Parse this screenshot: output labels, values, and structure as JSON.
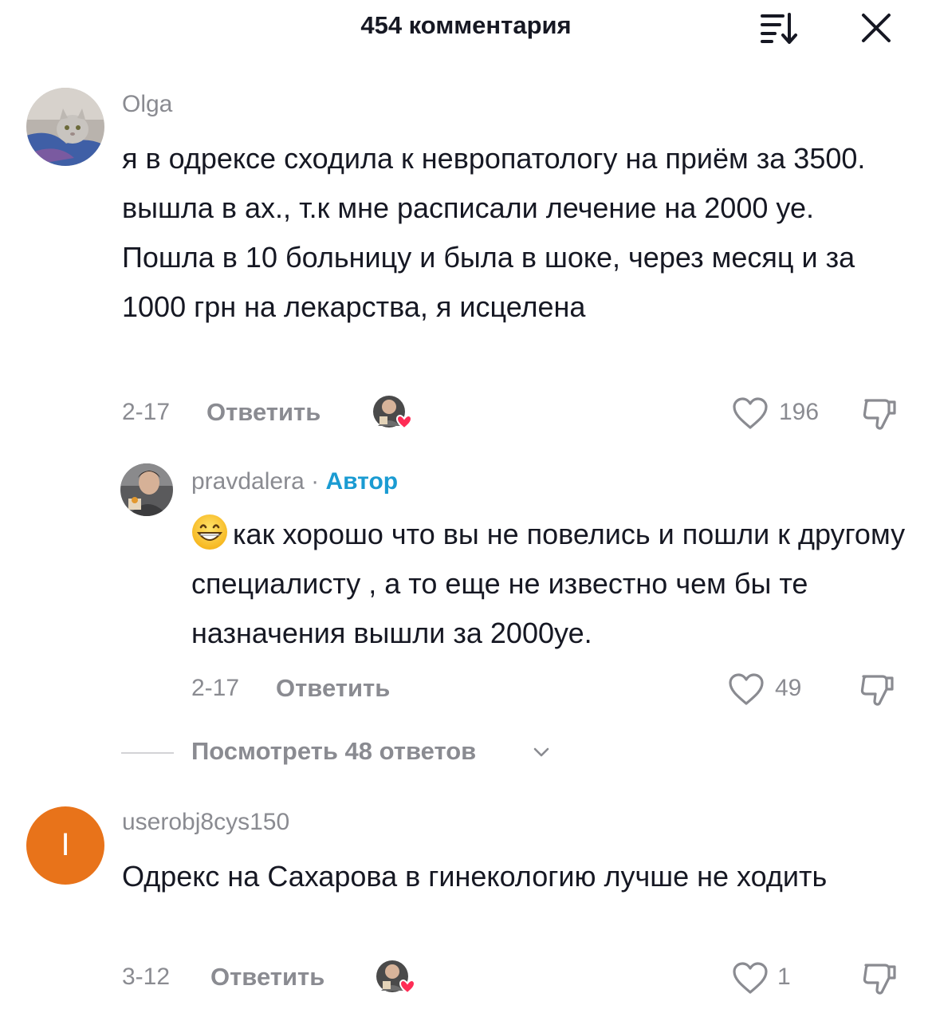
{
  "header": {
    "title": "454 комментария",
    "sort_icon": "sort-descending-icon",
    "close_icon": "close-icon"
  },
  "comments": [
    {
      "username": "Olga",
      "text": "я в одрексе сходила к невропатологу на приём за 3500. вышла в ах., т.к мне расписали лечение на 2000 уе. Пошла в 10 больницу и была в шоке, через месяц и за 1000 грн на лекарства, я исцелена",
      "date": "2-17",
      "reply_label": "Ответить",
      "likes": "196",
      "liked_by_author": true
    },
    {
      "username": "pravdalera",
      "separator": " · ",
      "author_badge": "Автор",
      "emoji": "grinning-face-emoji",
      "text": "как хорошо что вы не повелись и пошли к другому специалисту , а то еще не известно чем бы те назначения вышли за 2000уе.",
      "date": "2-17",
      "reply_label": "Ответить",
      "likes": "49"
    },
    {
      "username": "userobj8cys150",
      "avatar_letter": "I",
      "text": "Одрекс на Сахарова в гинекологию лучше не ходить",
      "date": "3-12",
      "reply_label": "Ответить",
      "likes": "1",
      "liked_by_author": true
    }
  ],
  "view_replies": {
    "label": "Посмотреть 48 ответов"
  },
  "colors": {
    "text": "#161823",
    "secondary": "#8a8b91",
    "author_badge": "#1a9bd2",
    "heart_badge": "#fe2c55",
    "letter_avatar": "#e8731a"
  }
}
